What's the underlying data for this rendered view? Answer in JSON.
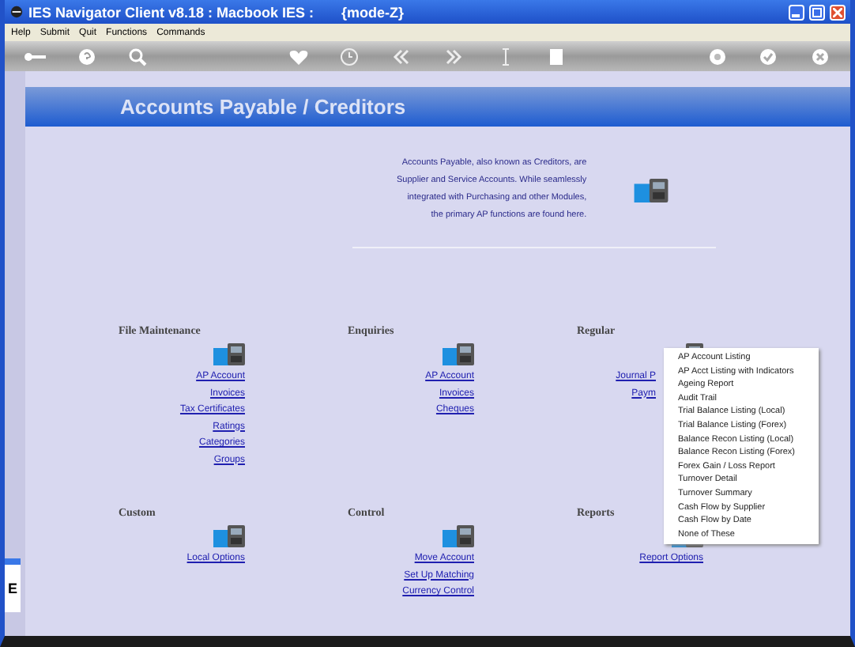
{
  "window": {
    "title": "IES Navigator Client v8.18 : Macbook IES :       {mode-Z}"
  },
  "menu": [
    "Help",
    "Submit",
    "Quit",
    "Functions",
    "Commands"
  ],
  "banner": {
    "title": "Accounts Payable / Creditors"
  },
  "description": [
    "Accounts Payable, also known as Creditors, are",
    "Supplier and Service Accounts. While seamlessly",
    "integrated with Purchasing and other Modules,",
    "the primary AP functions are found here."
  ],
  "sections": [
    {
      "title": "File Maintenance",
      "links": [
        "AP Account",
        "Invoices",
        "Tax Certificates",
        "Ratings",
        "Categories",
        "Groups"
      ]
    },
    {
      "title": "Enquiries",
      "links": [
        "AP Account",
        "Invoices",
        "Cheques"
      ]
    },
    {
      "title": "Regular",
      "links": [
        "Journal P",
        "Paym"
      ]
    },
    {
      "title": "Custom",
      "links": [
        "Local Options"
      ]
    },
    {
      "title": "Control",
      "links": [
        "Move Account",
        "Set Up Matching",
        "Currency Control"
      ]
    },
    {
      "title": "Reports",
      "links": [
        "Report Options"
      ]
    }
  ],
  "dropdown": [
    "AP Account Listing",
    "AP Acct Listing with Indicators",
    "Ageing Report",
    "Audit Trail",
    "Trial Balance Listing (Local)",
    "Trial Balance Listing (Forex)",
    "Balance Recon Listing (Local)",
    "Balance Recon Listing (Forex)",
    "Forex Gain / Loss Report",
    "Turnover Detail",
    "Turnover Summary",
    "Cash Flow by Supplier",
    "Cash Flow by Date",
    "None of These"
  ],
  "side_tab": {
    "label": "E"
  }
}
